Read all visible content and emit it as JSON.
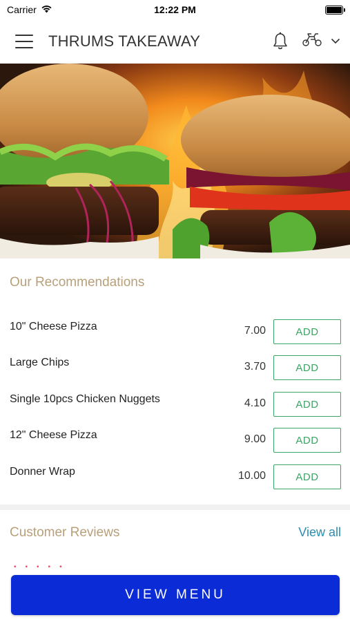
{
  "status_bar": {
    "carrier": "Carrier",
    "time": "12:22 PM"
  },
  "header": {
    "title": "THRUMS TAKEAWAY",
    "icons": [
      "menu-icon",
      "bell-icon",
      "scooter-icon",
      "chevron-down-icon"
    ]
  },
  "hero": {
    "image": "burgers-on-flames"
  },
  "recommendations": {
    "title": "Our Recommendations",
    "add_label": "ADD",
    "items": [
      {
        "name": "10\" Cheese Pizza",
        "price": "7.00"
      },
      {
        "name": "Large Chips",
        "price": "3.70"
      },
      {
        "name": "Single 10pcs Chicken Nuggets",
        "price": "4.10"
      },
      {
        "name": "12\" Cheese Pizza",
        "price": "9.00"
      },
      {
        "name": "Donner Wrap",
        "price": "10.00"
      }
    ]
  },
  "reviews": {
    "title": "Customer Reviews",
    "view_all": "View all",
    "star_count": 5
  },
  "cta": {
    "view_menu": "VIEW MENU"
  },
  "colors": {
    "accent_gold": "#b8a07a",
    "add_green": "#3aa564",
    "link_blue": "#2a8fb0",
    "cta_blue": "#0a2bd6"
  }
}
